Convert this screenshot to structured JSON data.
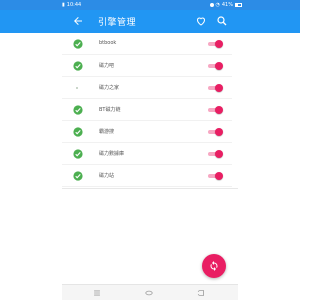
{
  "status_bar": {
    "time": "10:44",
    "carrier": "",
    "battery": "41%"
  },
  "app_bar": {
    "title": "引擎管理",
    "icons": [
      "back-arrow-icon",
      "heart-outline-icon",
      "search-icon"
    ]
  },
  "engines": [
    {
      "label": "btbook",
      "checked": true,
      "enabled": true
    },
    {
      "label": "磁力吧",
      "checked": true,
      "enabled": true
    },
    {
      "label": "磁力之家",
      "checked": false,
      "enabled": true
    },
    {
      "label": "BT磁力链",
      "checked": true,
      "enabled": true
    },
    {
      "label": "霸游搜",
      "checked": true,
      "enabled": true
    },
    {
      "label": "磁力數據庫",
      "checked": true,
      "enabled": true
    },
    {
      "label": "磁力站",
      "checked": true,
      "enabled": true
    }
  ],
  "fab": {
    "icon": "refresh-icon"
  },
  "nav_bar": {
    "icons": [
      "menu-icon",
      "home-icon",
      "back-icon"
    ]
  },
  "colors": {
    "primary": "#2196f3",
    "status_bar": "#2c8ce6",
    "accent": "#e91e63",
    "check": "#4caf50"
  }
}
